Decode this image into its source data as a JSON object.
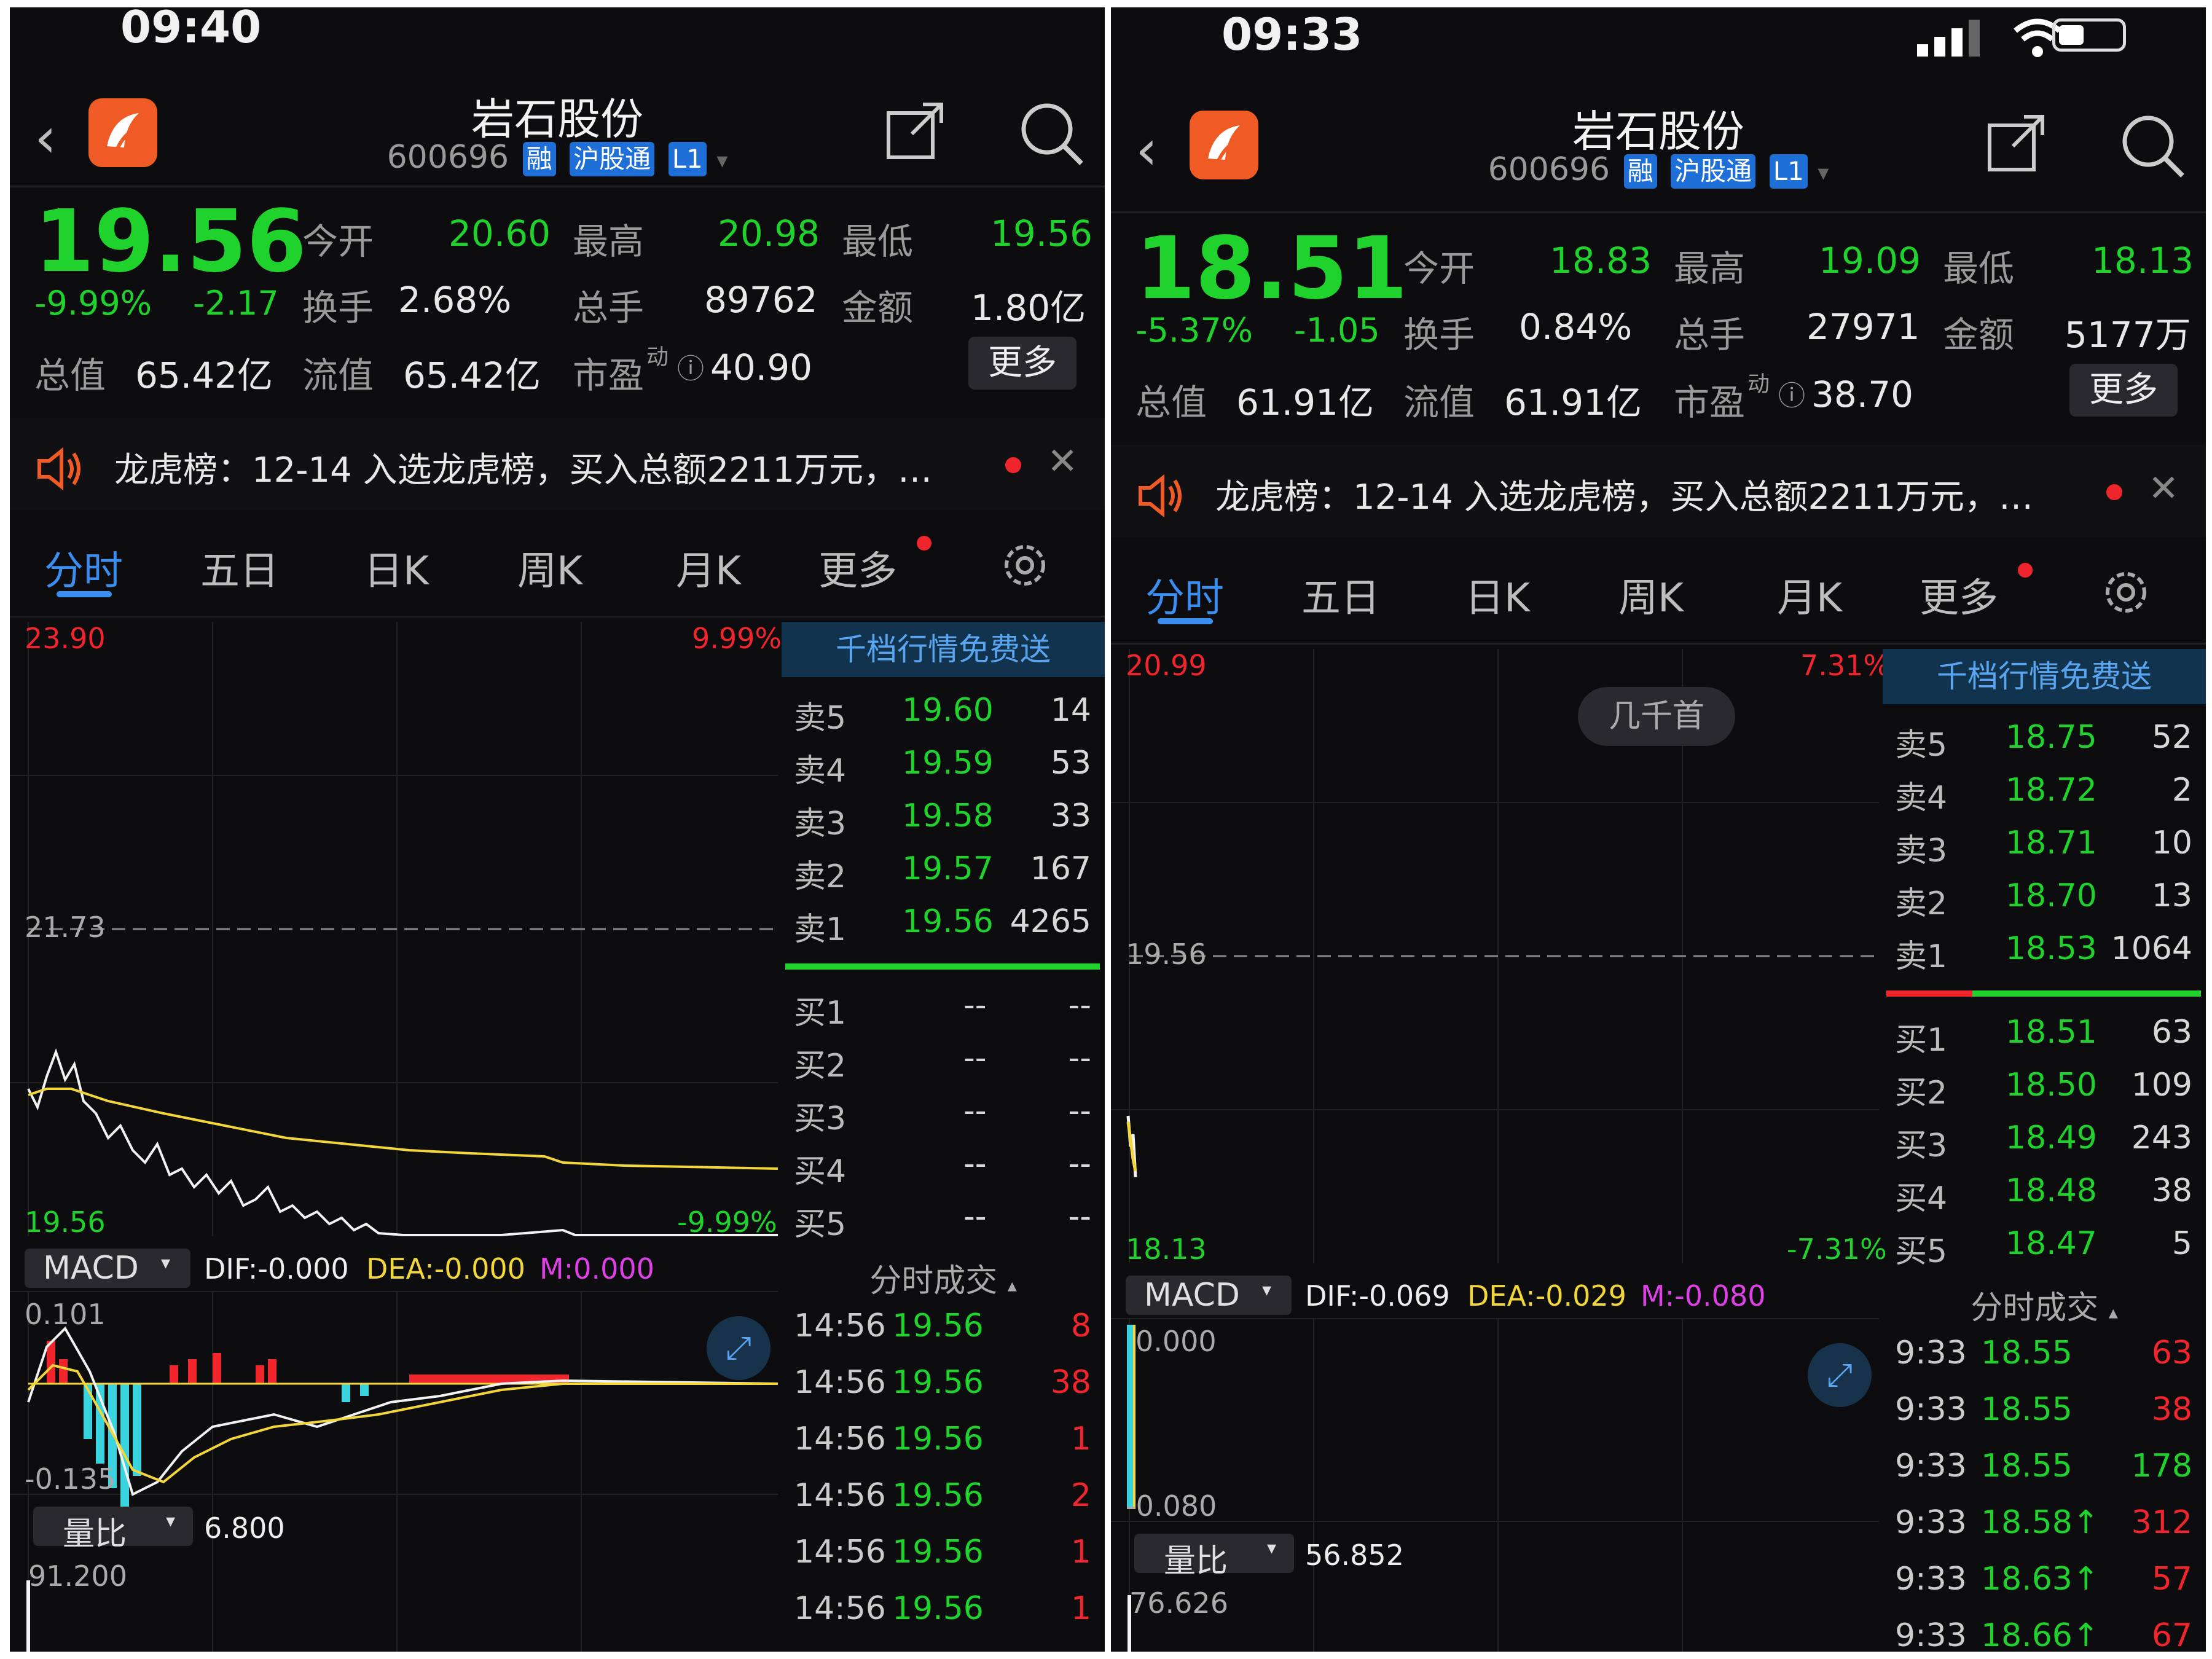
{
  "left": {
    "status_time": "09:40",
    "title": "岩石股份",
    "code": "600696",
    "tags": [
      "融",
      "沪股通",
      "L1"
    ],
    "price": "19.56",
    "change_pct": "-9.99%",
    "change": "-2.17",
    "stats": [
      {
        "label": "今开",
        "value": "20.60"
      },
      {
        "label": "最高",
        "value": "20.98"
      },
      {
        "label": "最低",
        "value": "19.56"
      },
      {
        "label": "换手",
        "value": "2.68%"
      },
      {
        "label": "总手",
        "value": "89762"
      },
      {
        "label": "金额",
        "value": "1.80亿"
      },
      {
        "label": "总值",
        "value": "65.42亿"
      },
      {
        "label": "流值",
        "value": "65.42亿"
      },
      {
        "label": "市盈",
        "value": "40.90"
      }
    ],
    "pe_sup": "动",
    "more_label": "更多",
    "news": "龙虎榜：12-14 入选龙虎榜，买入总额2211万元，…",
    "tabs": [
      "分时",
      "五日",
      "日K",
      "周K",
      "月K",
      "更多"
    ],
    "chart_labels": {
      "top": "23.90",
      "top_pct": "9.99%",
      "mid": "21.73",
      "bottom": "19.56",
      "bottom_pct": "-9.99%"
    },
    "macd": {
      "name": "MACD",
      "dif": "DIF:-0.000",
      "dea": "DEA:-0.000",
      "m": "M:0.000",
      "top": "0.101",
      "bottom": "-0.135"
    },
    "vol": {
      "name": "量比",
      "value": "6.800",
      "top": "91.200"
    },
    "side_header": "千档行情免费送",
    "sells": [
      {
        "label": "卖5",
        "price": "19.60",
        "vol": "14"
      },
      {
        "label": "卖4",
        "price": "19.59",
        "vol": "53"
      },
      {
        "label": "卖3",
        "price": "19.58",
        "vol": "33"
      },
      {
        "label": "卖2",
        "price": "19.57",
        "vol": "167"
      },
      {
        "label": "卖1",
        "price": "19.56",
        "vol": "4265"
      }
    ],
    "buys": [
      {
        "label": "买1",
        "price": "--",
        "vol": "--"
      },
      {
        "label": "买2",
        "price": "--",
        "vol": "--"
      },
      {
        "label": "买3",
        "price": "--",
        "vol": "--"
      },
      {
        "label": "买4",
        "price": "--",
        "vol": "--"
      },
      {
        "label": "买5",
        "price": "--",
        "vol": "--"
      }
    ],
    "trade_header": "分时成交",
    "trades": [
      {
        "time": "14:56",
        "price": "19.56",
        "vol": "8"
      },
      {
        "time": "14:56",
        "price": "19.56",
        "vol": "38"
      },
      {
        "time": "14:56",
        "price": "19.56",
        "vol": "1"
      },
      {
        "time": "14:56",
        "price": "19.56",
        "vol": "2"
      },
      {
        "time": "14:56",
        "price": "19.56",
        "vol": "1"
      },
      {
        "time": "14:56",
        "price": "19.56",
        "vol": "1"
      }
    ]
  },
  "right": {
    "status_time": "09:33",
    "title": "岩石股份",
    "code": "600696",
    "tags": [
      "融",
      "沪股通",
      "L1"
    ],
    "price": "18.51",
    "change_pct": "-5.37%",
    "change": "-1.05",
    "stats": [
      {
        "label": "今开",
        "value": "18.83"
      },
      {
        "label": "最高",
        "value": "19.09"
      },
      {
        "label": "最低",
        "value": "18.13"
      },
      {
        "label": "换手",
        "value": "0.84%"
      },
      {
        "label": "总手",
        "value": "27971"
      },
      {
        "label": "金额",
        "value": "5177万"
      },
      {
        "label": "总值",
        "value": "61.91亿"
      },
      {
        "label": "流值",
        "value": "61.91亿"
      },
      {
        "label": "市盈",
        "value": "38.70"
      }
    ],
    "pe_sup": "动",
    "more_label": "更多",
    "news": "龙虎榜：12-14 入选龙虎榜，买入总额2211万元，…",
    "tabs": [
      "分时",
      "五日",
      "日K",
      "周K",
      "月K",
      "更多"
    ],
    "chart_labels": {
      "top": "20.99",
      "top_pct": "7.31%",
      "mid": "19.56",
      "bottom": "18.13",
      "bottom_pct": "-7.31%"
    },
    "toast": "几千首",
    "macd": {
      "name": "MACD",
      "dif": "DIF:-0.069",
      "dea": "DEA:-0.029",
      "m": "M:-0.080",
      "top": "0.000",
      "bottom": "-0.080"
    },
    "vol": {
      "name": "量比",
      "value": "56.852",
      "top": "76.626"
    },
    "side_header": "千档行情免费送",
    "sells": [
      {
        "label": "卖5",
        "price": "18.75",
        "vol": "52"
      },
      {
        "label": "卖4",
        "price": "18.72",
        "vol": "2"
      },
      {
        "label": "卖3",
        "price": "18.71",
        "vol": "10"
      },
      {
        "label": "卖2",
        "price": "18.70",
        "vol": "13"
      },
      {
        "label": "卖1",
        "price": "18.53",
        "vol": "1064"
      }
    ],
    "buys": [
      {
        "label": "买1",
        "price": "18.51",
        "vol": "63"
      },
      {
        "label": "买2",
        "price": "18.50",
        "vol": "109"
      },
      {
        "label": "买3",
        "price": "18.49",
        "vol": "243"
      },
      {
        "label": "买4",
        "price": "18.48",
        "vol": "38"
      },
      {
        "label": "买5",
        "price": "18.47",
        "vol": "5"
      }
    ],
    "trade_header": "分时成交",
    "trades": [
      {
        "time": "9:33",
        "price": "18.55",
        "vol": "63"
      },
      {
        "time": "9:33",
        "price": "18.55",
        "vol": "38"
      },
      {
        "time": "9:33",
        "price": "18.55",
        "vol": "178"
      },
      {
        "time": "9:33",
        "price": "18.58↑",
        "vol": "312"
      },
      {
        "time": "9:33",
        "price": "18.63↑",
        "vol": "57"
      },
      {
        "time": "9:33",
        "price": "18.66↑",
        "vol": "67"
      }
    ]
  },
  "colors": {
    "up": "#f1252c",
    "down": "#1fd32c",
    "accent": "#3a8ef0",
    "avg": "#f2d63a"
  }
}
